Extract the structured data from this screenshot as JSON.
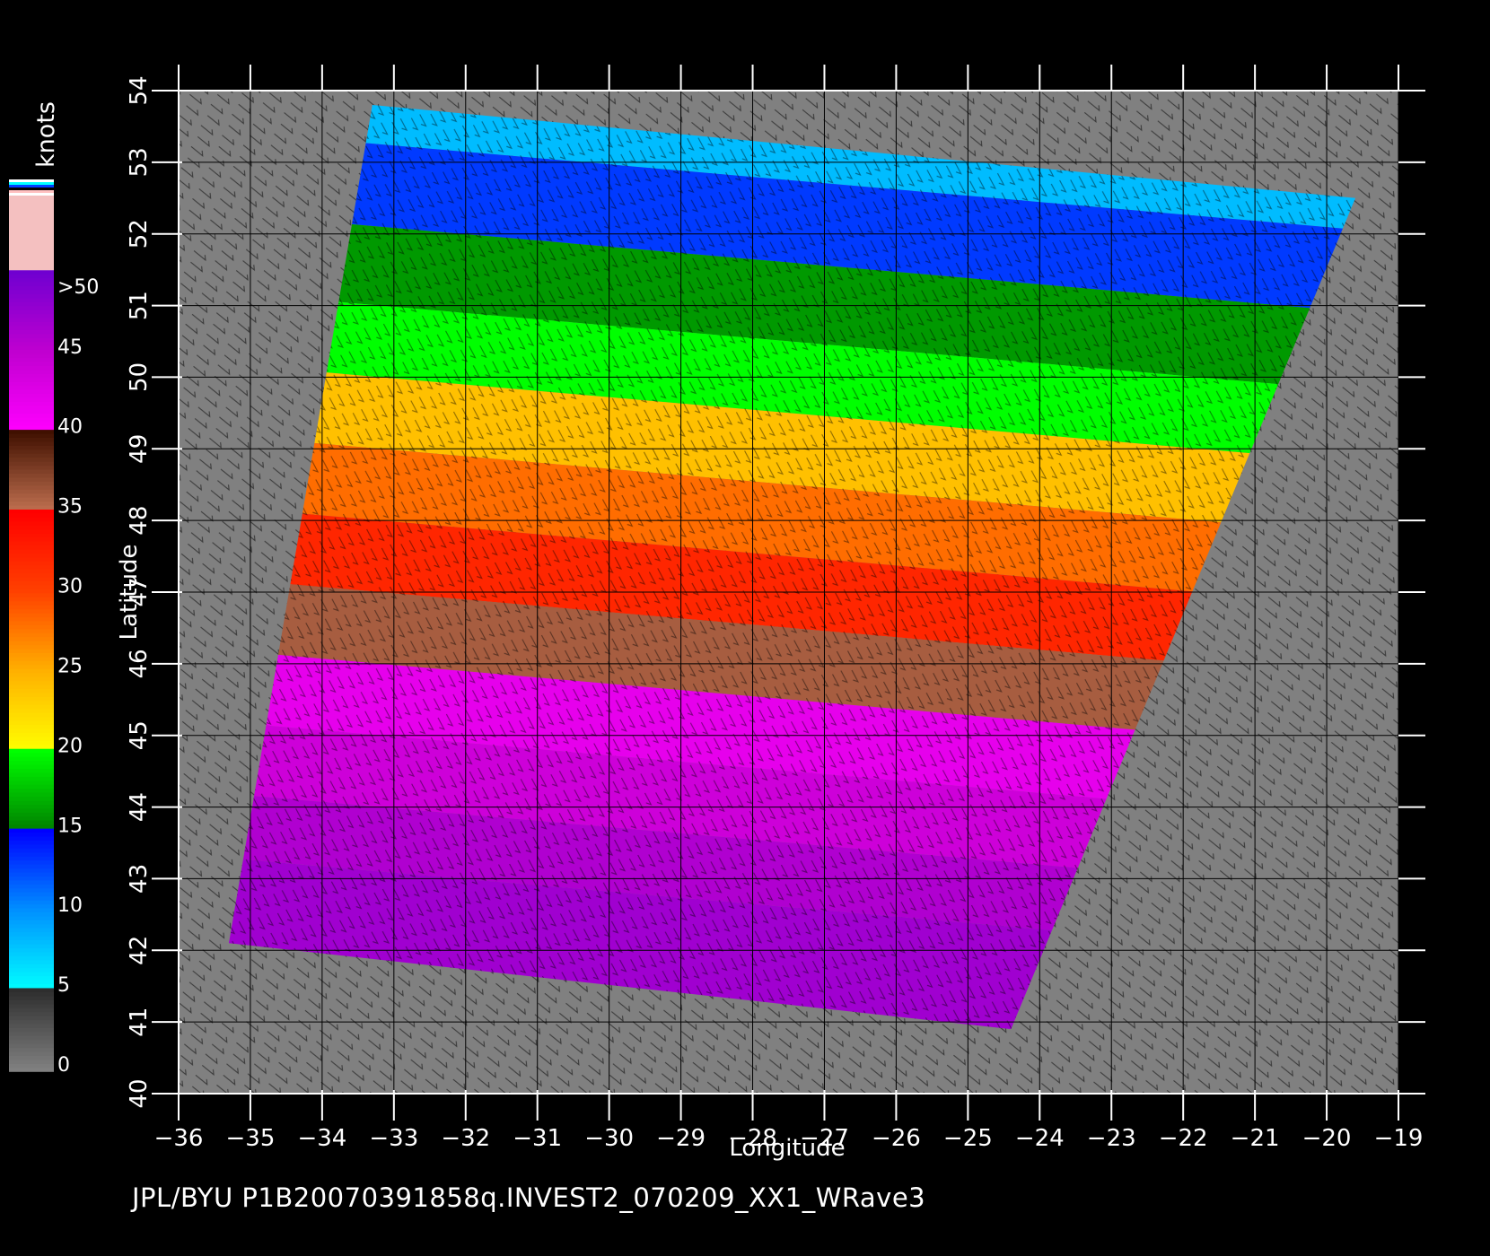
{
  "footer": {
    "text": "JPL/BYU  P1B20070391858q.INVEST2_070209_XX1_WRave3"
  },
  "colorbar": {
    "title": "knots",
    "labels": [
      ">50",
      "45",
      "40",
      "35",
      "30",
      "25",
      "20",
      "15",
      "10",
      "5",
      "0"
    ],
    "label_values": [
      50,
      45,
      40,
      35,
      30,
      25,
      20,
      15,
      10,
      5,
      0
    ],
    "min": 0,
    "max": 55,
    "stops": [
      {
        "v": 0,
        "color": "#808080"
      },
      {
        "v": 5,
        "color": "#2e2e2e"
      },
      {
        "v": 5.01,
        "color": "#00ffff"
      },
      {
        "v": 10,
        "color": "#0090ff"
      },
      {
        "v": 15,
        "color": "#0000ff"
      },
      {
        "v": 15.01,
        "color": "#008000"
      },
      {
        "v": 20,
        "color": "#00ff00"
      },
      {
        "v": 20.01,
        "color": "#ffff00"
      },
      {
        "v": 25,
        "color": "#ffb000"
      },
      {
        "v": 30,
        "color": "#ff4000"
      },
      {
        "v": 35,
        "color": "#ff0000"
      },
      {
        "v": 35.01,
        "color": "#c07050"
      },
      {
        "v": 40,
        "color": "#401000"
      },
      {
        "v": 40.01,
        "color": "#ff00ff"
      },
      {
        "v": 45,
        "color": "#c000d0"
      },
      {
        "v": 50,
        "color": "#7000d0"
      },
      {
        "v": 50.01,
        "color": "#f4c0c0"
      },
      {
        "v": 55,
        "color": "#f4c0c0"
      }
    ],
    "top_stripes": [
      "#ffffff",
      "#00ffff",
      "#0040ff",
      "#000000",
      "#ffc0c0",
      "#ffffff"
    ]
  },
  "chart_data": {
    "type": "heatmap",
    "title": "",
    "xlabel": "Longitude",
    "ylabel": "Latitude",
    "xlim": [
      -36,
      -19
    ],
    "ylim": [
      40,
      54
    ],
    "xticks": [
      "-36",
      "-35",
      "-34",
      "-33",
      "-32",
      "-31",
      "-30",
      "-29",
      "-28",
      "-27",
      "-26",
      "-25",
      "-24",
      "-23",
      "-22",
      "-21",
      "-20",
      "-19"
    ],
    "yticks": [
      "40",
      "41",
      "42",
      "43",
      "44",
      "45",
      "46",
      "47",
      "48",
      "49",
      "50",
      "51",
      "52",
      "53",
      "54"
    ],
    "grid": true,
    "background_color": "#808080",
    "swath_corners_lonlat": [
      [
        -33.3,
        53.8
      ],
      [
        -19.6,
        52.5
      ],
      [
        -24.4,
        40.9
      ],
      [
        -35.3,
        42.1
      ]
    ],
    "wind_speed_knots_by_band_lat": [
      {
        "lat": 53.3,
        "speed": 8
      },
      {
        "lat": 52.2,
        "speed": 13
      },
      {
        "lat": 51.0,
        "speed": 16
      },
      {
        "lat": 50.0,
        "speed": 20
      },
      {
        "lat": 49.0,
        "speed": 24
      },
      {
        "lat": 48.0,
        "speed": 28
      },
      {
        "lat": 47.0,
        "speed": 32
      },
      {
        "lat": 46.0,
        "speed": 36
      },
      {
        "lat": 45.0,
        "speed": 42
      },
      {
        "lat": 44.0,
        "speed": 44
      },
      {
        "lat": 43.0,
        "speed": 46
      },
      {
        "lat": 42.2,
        "speed": 47
      }
    ]
  }
}
